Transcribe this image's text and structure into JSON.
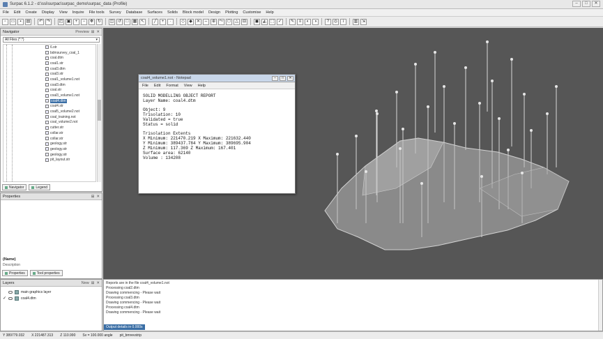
{
  "window": {
    "title": "Surpac 6.1.2 - d:\\ssi\\surpac\\surpac_demo\\surpac_data (Profile)",
    "controls": [
      "–",
      "□",
      "✕"
    ]
  },
  "menu": [
    "File",
    "Edit",
    "Create",
    "Display",
    "View",
    "Inquire",
    "File tools",
    "Survey",
    "Database",
    "Surfaces",
    "Solids",
    "Block model",
    "Design",
    "Plotting",
    "Customise",
    "Help"
  ],
  "navigator": {
    "title": "Navigator",
    "preview_label": "Preview",
    "filter": "All Files (*.*)",
    "files": [
      "6.str",
      "bdmsurvey_coal_1",
      "coal.dtm",
      "coal1.str",
      "coal3.dtm",
      "coal3.str",
      "coal1_volume1.not",
      "coal3.dtm",
      "coal.str",
      "coal3_volume1.not",
      "coal4.dtm",
      "coal4.str",
      "coal5_volume2.not",
      "coal_training.not",
      "coal_volume2.not",
      "cutter.str",
      "collar.str",
      "collar.str",
      "geology.str",
      "geology.str",
      "geology.str",
      "pit_layout.str"
    ],
    "selected_index": 10,
    "tabs": [
      "Navigator",
      "Legend"
    ]
  },
  "properties": {
    "title": "Properties",
    "name_label": "(Name)",
    "description_label": "Description",
    "tabs": [
      "Properties",
      "Tool properties"
    ]
  },
  "layers": {
    "title": "Layers",
    "new_label": "New",
    "rows": [
      {
        "check": "",
        "label": "main graphics layer"
      },
      {
        "check": "✓",
        "label": "coal4.dtm"
      }
    ]
  },
  "report": {
    "title": "coal4_volume1.not - Notepad",
    "menu": [
      "File",
      "Edit",
      "Format",
      "View",
      "Help"
    ],
    "lines": [
      "SOLID MODELLING OBJECT REPORT",
      "Layer Name: coal4.dtm",
      "",
      "Object: 9",
      "Trisolation: 10",
      "Validated = true",
      "Status = solid",
      "",
      "Trisolation Extents",
      "X Minimum: 221470.219 X Maximum: 221632.440",
      "Y Minimum: 389437.784 Y Maximum: 389695.904",
      "Z Minimum: 117.369 Z Maximum: 167.401",
      "Surface area: 62140",
      "Volume : 134208"
    ]
  },
  "output": {
    "lines": [
      "Reports are in the file coal4_volume1.not",
      "Processing coal2.dtm",
      "Drawing commencing - Please wait",
      "Processing coal3.dtm",
      "Drawing commencing - Please wait",
      "Processing coal4.dtm",
      "Drawing commencing - Please wait"
    ],
    "status": "Output details in 0.000s"
  },
  "statusbar": {
    "x": "Y 389779.032",
    "y": "X 221487.313",
    "z": "Z 110.990",
    "scale": "Sv = 100.000 angle",
    "path": "pit_bmrevstrip"
  },
  "colors": {
    "viewport": "#565656",
    "solid": "#b6b6b6",
    "selection": "#3a6ea5"
  }
}
